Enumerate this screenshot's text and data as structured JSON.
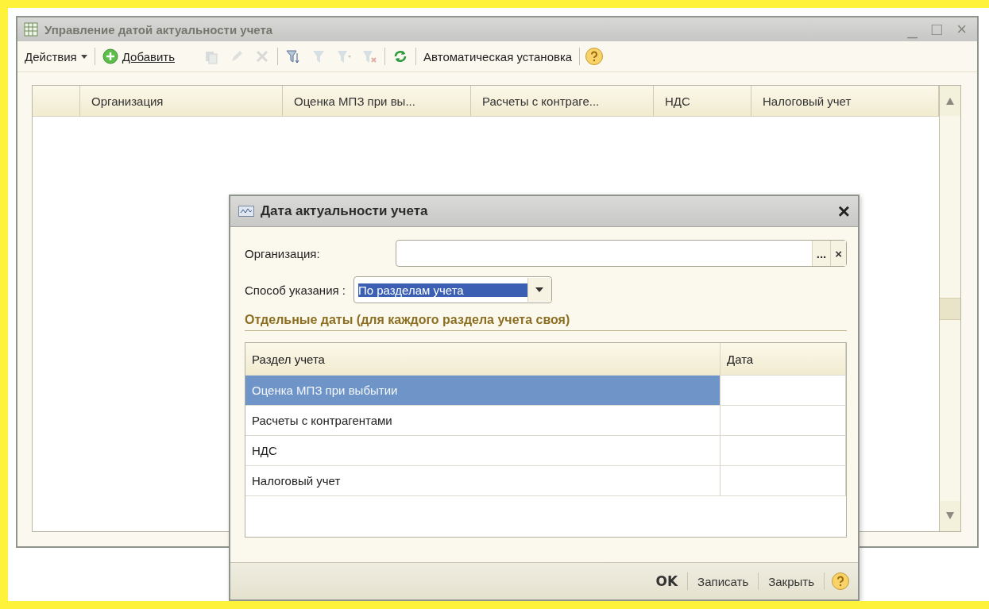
{
  "main_window": {
    "title": "Управление датой актуальности учета",
    "window_controls": [
      "_",
      "□",
      "×"
    ],
    "toolbar": {
      "actions_menu": "Действия",
      "add_button": "Добавить",
      "auto_set_button": "Автоматическая установка",
      "tools": [
        {
          "disabled": true
        },
        {
          "disabled": true
        },
        {
          "disabled": true
        },
        {
          "disabled": false
        },
        {
          "disabled": true
        },
        {
          "disabled": true
        },
        {
          "disabled": true
        },
        {
          "disabled": false
        }
      ]
    },
    "table": {
      "columns": [
        "Организация",
        "Оценка МПЗ при вы...",
        "Расчеты с контраге...",
        "НДС",
        "Налоговый учет"
      ]
    }
  },
  "dialog": {
    "title": "Дата актуальности учета",
    "close": "×",
    "organization": {
      "label": "Организация:",
      "select_button": "...",
      "clear_button": "×"
    },
    "method": {
      "label": "Способ указания :",
      "value": "По разделам учета",
      "selected": true
    },
    "section_title": "Отдельные даты (для каждого раздела учета своя)",
    "table": {
      "columns": [
        "Раздел учета",
        "Дата"
      ],
      "rows": [
        {
          "section": "Оценка МПЗ при выбытии",
          "selected": true
        },
        {
          "section": "Расчеты с контрагентами",
          "selected": false
        },
        {
          "section": "НДС",
          "selected": false
        },
        {
          "section": "Налоговый учет",
          "selected": false
        }
      ]
    },
    "footer": {
      "ok": "OK",
      "save": "Записать",
      "close": "Закрыть"
    }
  }
}
